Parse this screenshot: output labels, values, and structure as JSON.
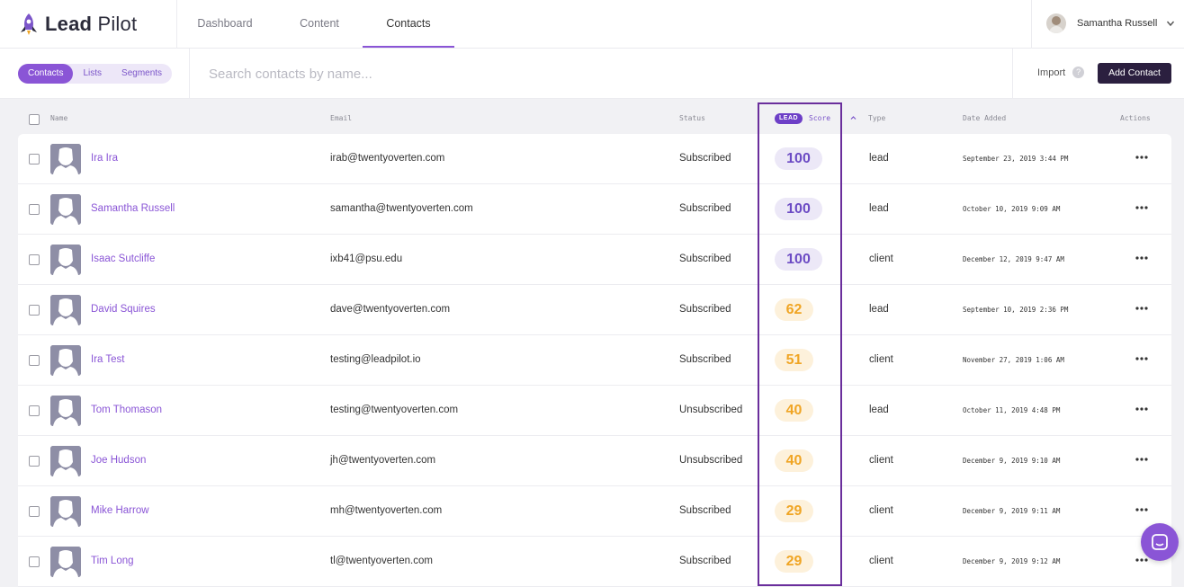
{
  "brand": {
    "name_bold": "Lead",
    "name_light": "Pilot"
  },
  "nav": {
    "tabs": [
      "Dashboard",
      "Content",
      "Contacts"
    ],
    "active": "Contacts"
  },
  "user": {
    "name": "Samantha Russell"
  },
  "subnav": {
    "pills": [
      "Contacts",
      "Lists",
      "Segments"
    ],
    "active": "Contacts"
  },
  "search": {
    "placeholder": "Search contacts by name...",
    "value": ""
  },
  "toolbar": {
    "import_label": "Import",
    "help_glyph": "?",
    "add_label": "Add Contact"
  },
  "table": {
    "headers": {
      "name": "Name",
      "email": "Email",
      "status": "Status",
      "score_badge": "LEAD",
      "score": "Score",
      "type": "Type",
      "date": "Date Added",
      "actions": "Actions"
    },
    "rows": [
      {
        "name": "Ira Ira",
        "email": "irab@twentyoverten.com",
        "status": "Subscribed",
        "score": "100",
        "level": "high",
        "type": "lead",
        "date": "September 23, 2019 3:44 PM"
      },
      {
        "name": "Samantha Russell",
        "email": "samantha@twentyoverten.com",
        "status": "Subscribed",
        "score": "100",
        "level": "high",
        "type": "lead",
        "date": "October 10, 2019 9:09 AM"
      },
      {
        "name": "Isaac Sutcliffe",
        "email": "ixb41@psu.edu",
        "status": "Subscribed",
        "score": "100",
        "level": "high",
        "type": "client",
        "date": "December 12, 2019 9:47 AM"
      },
      {
        "name": "David Squires",
        "email": "dave@twentyoverten.com",
        "status": "Subscribed",
        "score": "62",
        "level": "mid",
        "type": "lead",
        "date": "September 10, 2019 2:36 PM"
      },
      {
        "name": "Ira Test",
        "email": "testing@leadpilot.io",
        "status": "Subscribed",
        "score": "51",
        "level": "mid",
        "type": "client",
        "date": "November 27, 2019 1:06 AM"
      },
      {
        "name": "Tom Thomason",
        "email": "testing@twentyoverten.com",
        "status": "Unsubscribed",
        "score": "40",
        "level": "mid",
        "type": "lead",
        "date": "October 11, 2019 4:48 PM"
      },
      {
        "name": "Joe Hudson",
        "email": "jh@twentyoverten.com",
        "status": "Unsubscribed",
        "score": "40",
        "level": "mid",
        "type": "client",
        "date": "December 9, 2019 9:10 AM"
      },
      {
        "name": "Mike Harrow",
        "email": "mh@twentyoverten.com",
        "status": "Subscribed",
        "score": "29",
        "level": "mid",
        "type": "client",
        "date": "December 9, 2019 9:11 AM"
      },
      {
        "name": "Tim Long",
        "email": "tl@twentyoverten.com",
        "status": "Subscribed",
        "score": "29",
        "level": "mid",
        "type": "client",
        "date": "December 9, 2019 9:12 AM"
      }
    ]
  },
  "colors": {
    "accent": "#8a55d6",
    "dark_button": "#2b1f3f",
    "score_high_bg": "#ece8f7",
    "score_high_text": "#6c4bc4",
    "score_mid_bg": "#fdf1db",
    "score_mid_text": "#f0a524",
    "highlight_border": "#6a2e9c"
  },
  "icons": {
    "logo": "rocket-icon",
    "user_menu": "chevron-down-icon",
    "help": "help-icon",
    "sort": "sort-ascending-icon",
    "row_actions": "more-horizontal-icon",
    "avatar": "default-avatar-icon",
    "chat": "chat-icon"
  }
}
